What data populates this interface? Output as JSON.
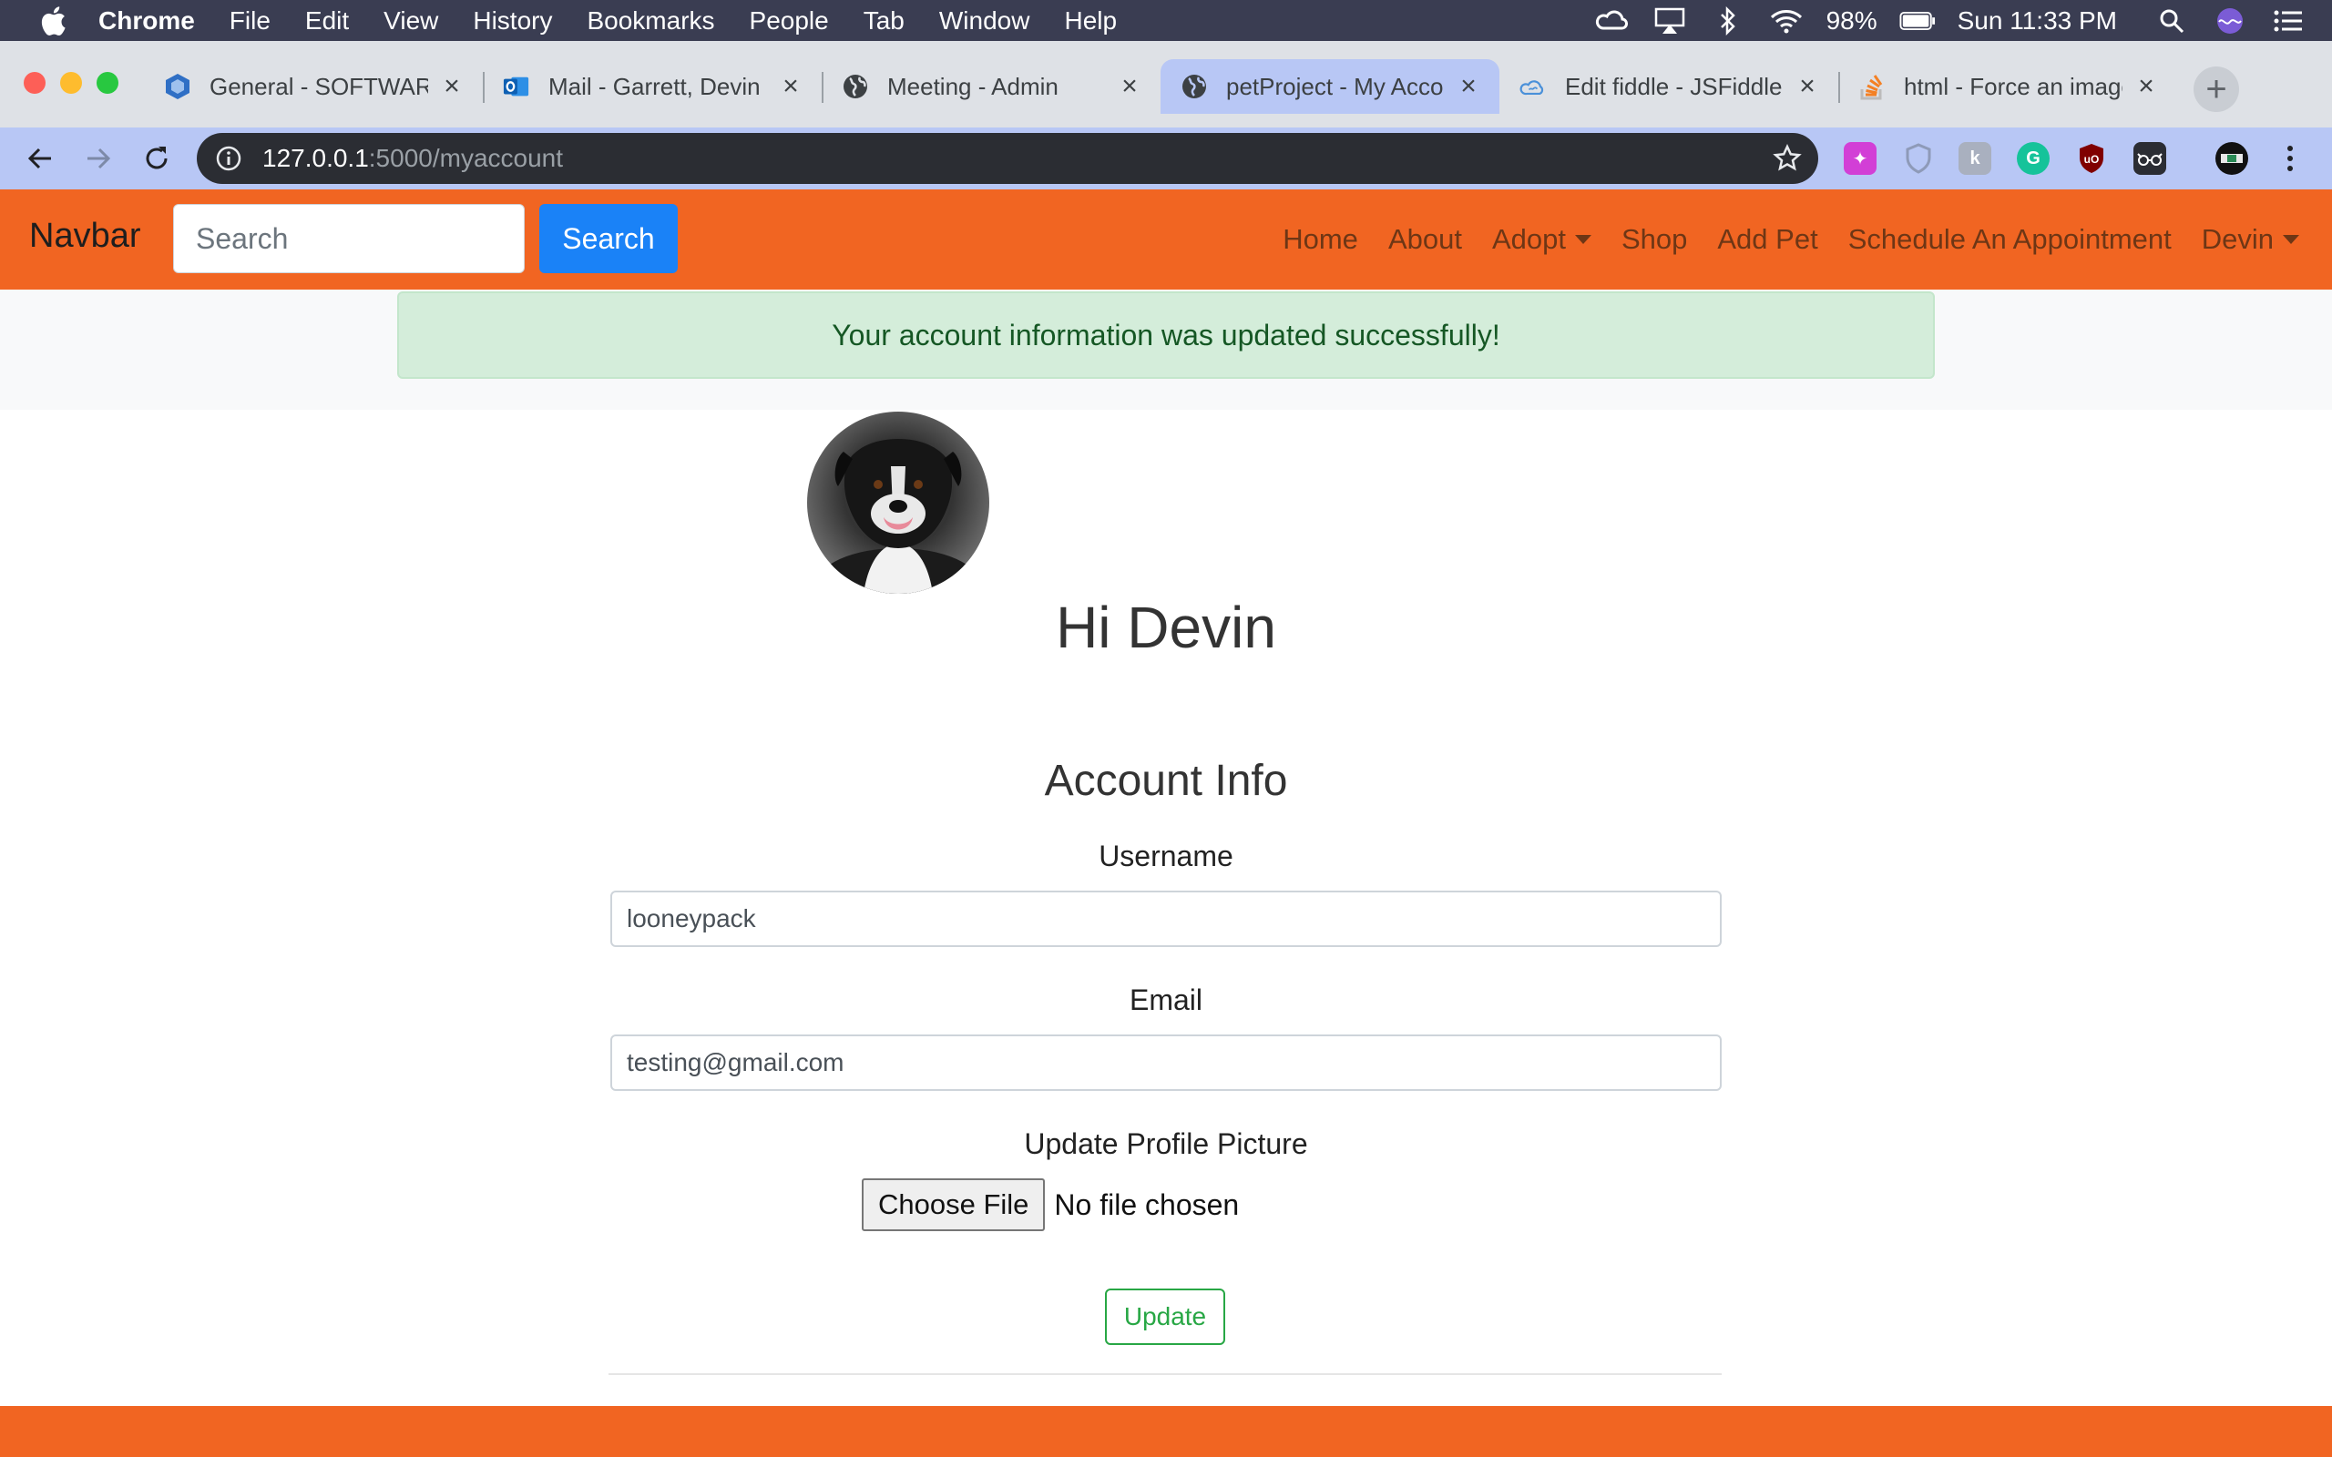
{
  "menubar": {
    "app_name": "Chrome",
    "items": [
      "File",
      "Edit",
      "View",
      "History",
      "Bookmarks",
      "People",
      "Tab",
      "Window",
      "Help"
    ],
    "battery": "98%",
    "clock": "Sun 11:33 PM"
  },
  "browser": {
    "tabs": [
      {
        "title": "General - SOFTWARE",
        "icon": "teams-icon"
      },
      {
        "title": "Mail - Garrett, Devin - Outlook",
        "icon": "outlook-icon"
      },
      {
        "title": "Meeting - Admin",
        "icon": "globe-icon"
      },
      {
        "title": "petProject - My Account",
        "icon": "globe-icon",
        "active": true
      },
      {
        "title": "Edit fiddle - JSFiddle",
        "icon": "jsfiddle-icon"
      },
      {
        "title": "html - Force an image",
        "icon": "stackoverflow-icon"
      }
    ],
    "url_host": "127.0.0.1",
    "url_path": ":5000/myaccount"
  },
  "navbar": {
    "brand": "Navbar",
    "search_placeholder": "Search",
    "search_button": "Search",
    "links": {
      "home": "Home",
      "about": "About",
      "adopt": "Adopt",
      "shop": "Shop",
      "add_pet": "Add Pet",
      "schedule": "Schedule An Appointment",
      "user": "Devin"
    }
  },
  "alert": {
    "message": "Your account information was updated successfully!"
  },
  "account": {
    "greeting": "Hi Devin",
    "section_title": "Account Info",
    "username_label": "Username",
    "username_value": "looneypack",
    "email_label": "Email",
    "email_value": "testing@gmail.com",
    "picture_label": "Update Profile Picture",
    "choose_file": "Choose File",
    "file_status": "No file chosen",
    "update_button": "Update"
  },
  "colors": {
    "navbar": "#f16522",
    "primary": "#1a82f7",
    "success": "#28a745",
    "alert_bg": "#d4edda"
  }
}
